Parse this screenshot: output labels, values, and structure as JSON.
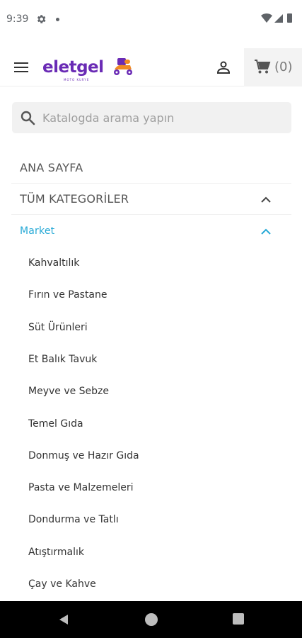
{
  "status": {
    "time": "9:39",
    "icons": [
      "gear-icon",
      "dot-icon",
      "wifi-icon",
      "signal-icon",
      "battery-icon"
    ]
  },
  "header": {
    "brand": "eletgel",
    "brand_tagline": "MOTO KURYE",
    "cart_count": "(0)",
    "icons": [
      "hamburger-menu-icon",
      "user-icon",
      "cart-icon"
    ]
  },
  "search": {
    "placeholder": "Katalogda arama yapın",
    "value": ""
  },
  "menu": {
    "home": "ANA SAYFA",
    "all_categories": "TÜM KATEGORİLER",
    "market": "Market",
    "market_items": [
      "Kahvaltılık",
      "Fırın ve Pastane",
      "Süt Ürünleri",
      "Et Balık Tavuk",
      "Meyve ve Sebze",
      "Temel Gıda",
      "Donmuş ve Hazır Gıda",
      "Pasta ve Malzemeleri",
      "Dondurma ve Tatlı",
      "Atıştırmalık",
      "Çay ve Kahve"
    ]
  },
  "colors": {
    "brand": "#6a2bb5",
    "accent": "#26a9d6"
  }
}
